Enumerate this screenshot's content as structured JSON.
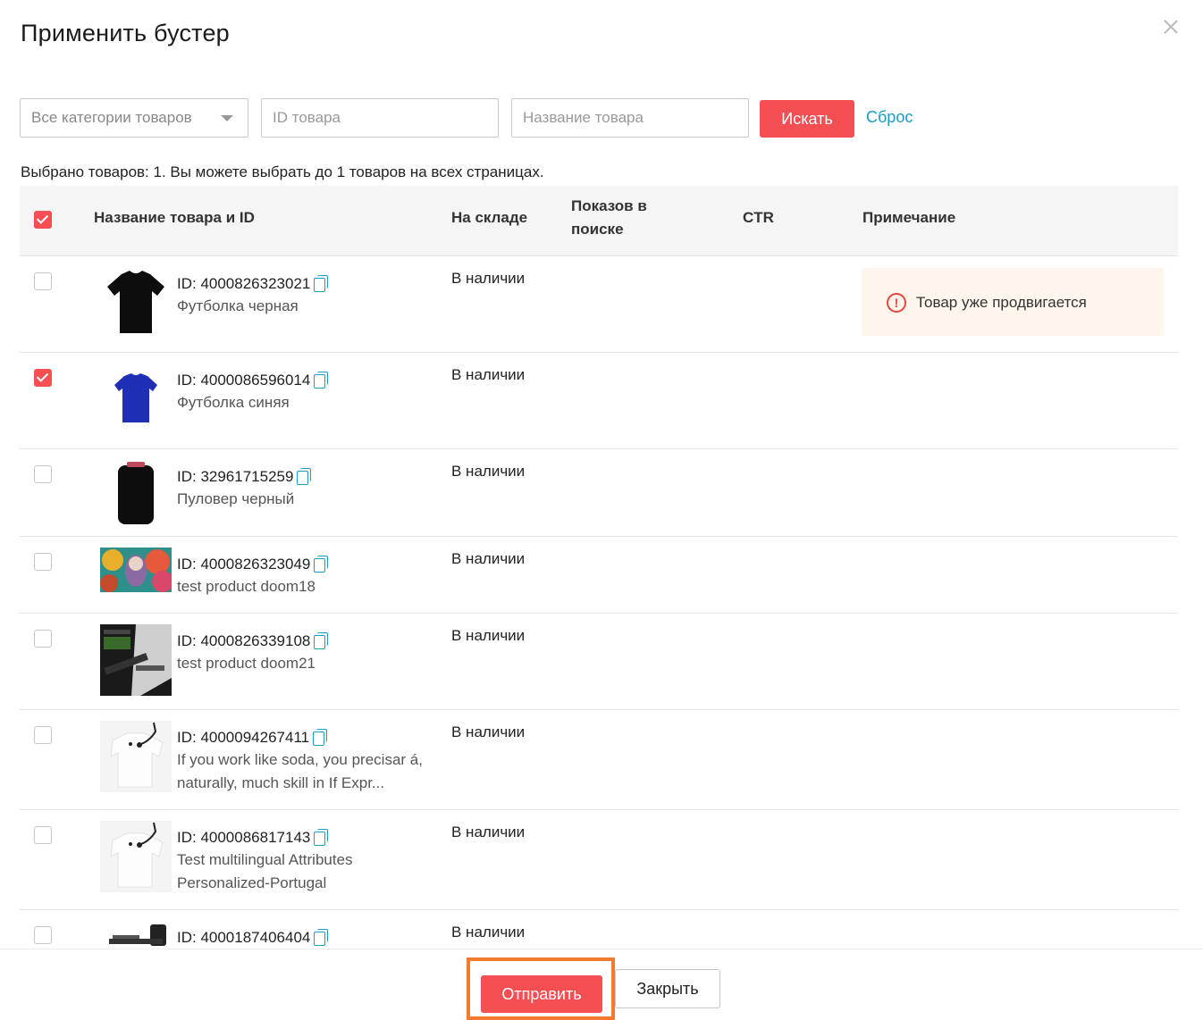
{
  "dialog": {
    "title": "Применить бустер",
    "close_glyph": "×"
  },
  "filters": {
    "category_value": "Все категории товаров",
    "id_placeholder": "ID товара",
    "name_placeholder": "Название товара",
    "search_label": "Искать",
    "reset_label": "Сброс"
  },
  "selected_info": "Выбрано товаров: 1. Вы можете выбрать до 1 товаров на всех страницах.",
  "table": {
    "header_checked": true,
    "columns": {
      "name": "Название товара и ID",
      "stock": "На складе",
      "impressions": "Показов в поиске",
      "ctr": "CTR",
      "note": "Примечание"
    },
    "rows": [
      {
        "id": "ID: 4000826323021",
        "name": "Футболка черная",
        "stock": "В наличии",
        "checked": false,
        "note": "Товар уже продвигается",
        "icon": "copy-icon"
      },
      {
        "id": "ID: 4000086596014",
        "name": "Футболка синяя",
        "stock": "В наличии",
        "checked": true,
        "note": "",
        "icon": "copy-icon"
      },
      {
        "id": "ID: 32961715259",
        "name": "Пуловер черный",
        "stock": "В наличии",
        "checked": false,
        "note": "",
        "icon": "copy-icon"
      },
      {
        "id": "ID: 4000826323049",
        "name": "test product doom18",
        "stock": "В наличии",
        "checked": false,
        "note": "",
        "icon": "copy-icon"
      },
      {
        "id": "ID: 4000826339108",
        "name": "test product doom21",
        "stock": "В наличии",
        "checked": false,
        "note": "",
        "icon": "copy-icon"
      },
      {
        "id": "ID: 4000094267411",
        "name": "If you work like soda, you precisar á, naturally, much skill in If Expr...",
        "stock": "В наличии",
        "checked": false,
        "note": "",
        "icon": "copy-icon"
      },
      {
        "id": "ID: 4000086817143",
        "name": "Test multilingual Attributes Personalized-Portugal",
        "stock": "В наличии",
        "checked": false,
        "note": "",
        "icon": "copy-icon"
      },
      {
        "id": "ID: 4000187406404",
        "name": "",
        "stock": "В наличии",
        "checked": false,
        "note": "",
        "icon": "copy-icon"
      }
    ]
  },
  "footer": {
    "submit_label": "Отправить",
    "close_label": "Закрыть"
  },
  "colors": {
    "accent": "#f54f54",
    "link": "#1a9cc4",
    "highlight_border": "#f47a2d",
    "warning_bg": "#fef5ec",
    "warning_icon": "#e8453c"
  }
}
